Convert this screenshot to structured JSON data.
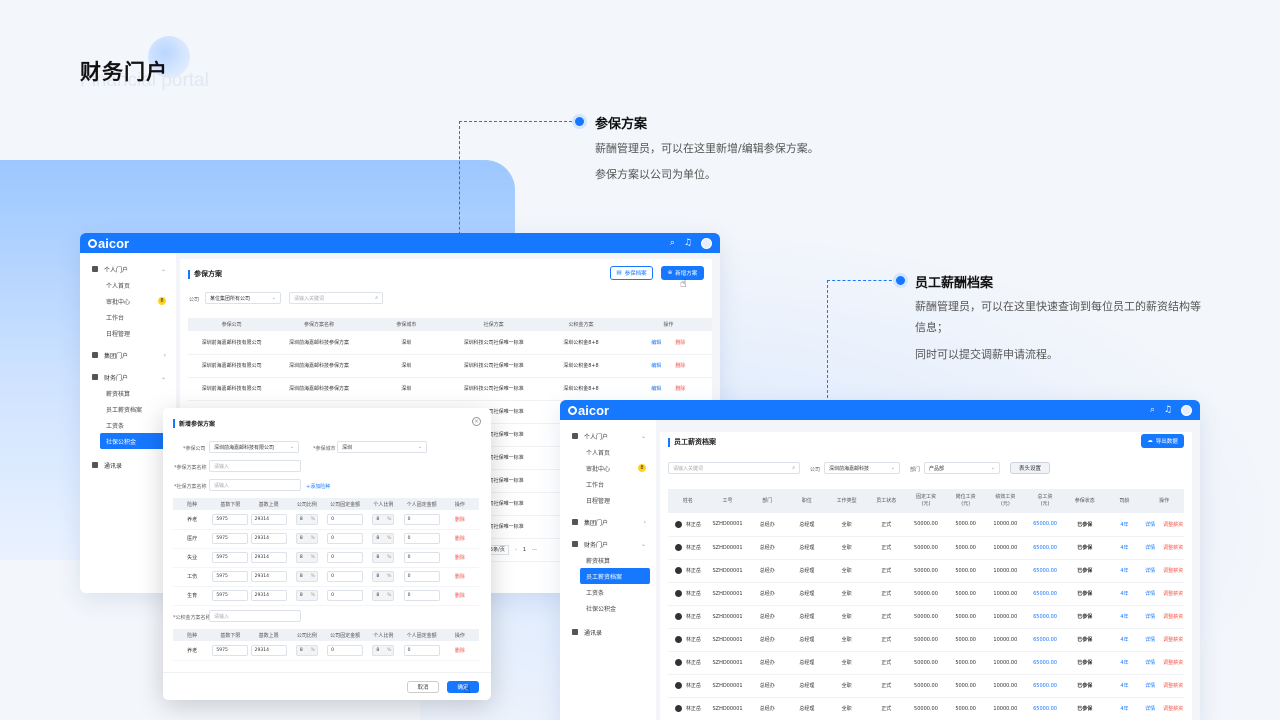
{
  "hero": {
    "title": "财务门户",
    "subtitle": "Financial portal"
  },
  "callout1": {
    "title": "参保方案",
    "line1": "薪酬管理员，可以在这里新增/编辑参保方案。",
    "line2": "参保方案以公司为单位。"
  },
  "callout2": {
    "title": "员工薪酬档案",
    "line1": "薪酬管理员，可以在这里快速查询到每位员工的薪资结构等",
    "line1b": "信息；",
    "line2": "同时可以提交调薪申请流程。"
  },
  "app": {
    "logo": "aicor"
  },
  "sidebar": {
    "personal": "个人门户",
    "personal_home": "个人首页",
    "approval": "审批中心",
    "approval_badge": "8",
    "workbench": "工作台",
    "schedule": "日程管理",
    "group": "集团门户",
    "finance": "财务门户",
    "salary_calc": "薪资核算",
    "salary_file": "员工薪资档案",
    "payslip": "工资条",
    "social": "社保公积金",
    "contacts": "通讯录"
  },
  "win1": {
    "page_title": "参保方案",
    "btn_archive": "参保档案",
    "btn_add": "新增方案",
    "company_label": "公司",
    "company_value": "某位集团所有公司",
    "search_placeholder": "请输入关键词",
    "columns": [
      "参保公司",
      "参保方案名称",
      "参保城市",
      "社保方案",
      "公积金方案",
      "操作"
    ],
    "rows": [
      [
        "深圳前海嘉邮科技有限公司",
        "深圳前海嘉邮科技参保方案",
        "深圳",
        "深圳科技公司社保唯一标准",
        "深圳公积金8+8",
        "编辑",
        "删除"
      ],
      [
        "深圳前海嘉邮科技有限公司",
        "深圳前海嘉邮科技参保方案",
        "深圳",
        "深圳科技公司社保唯一标准",
        "深圳公积金8+8",
        "编辑",
        "删除"
      ],
      [
        "深圳前海嘉邮科技有限公司",
        "深圳前海嘉邮科技参保方案",
        "深圳",
        "深圳科技公司社保唯一标准",
        "深圳公积金8+8",
        "编辑",
        "删除"
      ]
    ],
    "extra_rows": [
      "深圳科技公司社保唯一标准",
      "深圳科技公司社保唯一标准",
      "深圳科技公司社保唯一标准",
      "深圳科技公司社保唯一标准",
      "深圳科技公司社保唯一标准",
      "深圳科技公司社保唯一标准"
    ],
    "pager_size": "5条/页",
    "pager_prev": "‹",
    "pager_page": "1",
    "pager_more": "···"
  },
  "modal": {
    "title": "新增参保方案",
    "company_label": "*参保公司",
    "company_value": "深圳前海嘉邮科技有限公司",
    "city_label": "*参保城市",
    "city_value": "深圳",
    "name_label": "*参保方案名称",
    "name_placeholder": "请输入",
    "social_label": "*社保方案名称",
    "social_placeholder": "请输入",
    "add_type": "+添加险种",
    "columns": [
      "险种",
      "基数下限",
      "基数上限",
      "公司比例",
      "公司固定金额",
      "个人比例",
      "个人固定金额",
      "操作"
    ],
    "rows": [
      {
        "type": "养老",
        "low": "5975",
        "high": "29314",
        "cr": "8",
        "cf": "0",
        "pr": "8",
        "pf": "0",
        "op": "删除"
      },
      {
        "type": "医疗",
        "low": "5975",
        "high": "29314",
        "cr": "8",
        "cf": "0",
        "pr": "8",
        "pf": "0",
        "op": "删除"
      },
      {
        "type": "失业",
        "low": "5975",
        "high": "29314",
        "cr": "8",
        "cf": "0",
        "pr": "8",
        "pf": "0",
        "op": "删除"
      },
      {
        "type": "工伤",
        "low": "5975",
        "high": "29314",
        "cr": "8",
        "cf": "0",
        "pr": "8",
        "pf": "0",
        "op": "删除"
      },
      {
        "type": "生育",
        "low": "5975",
        "high": "29314",
        "cr": "8",
        "cf": "0",
        "pr": "8",
        "pf": "0",
        "op": "删除"
      }
    ],
    "fund_label": "*公积金方案名称",
    "fund_placeholder": "请输入",
    "fund_rows": [
      {
        "type": "养老",
        "low": "5975",
        "high": "29314",
        "cr": "8",
        "cf": "0",
        "pr": "8",
        "pf": "0",
        "op": "删除"
      }
    ],
    "pct": "%",
    "cancel": "取消",
    "confirm": "确定"
  },
  "win2": {
    "page_title": "员工薪资档案",
    "btn_export": "导出数据",
    "search_placeholder": "请输入关键词",
    "company_label": "公司",
    "company_value": "深圳前海嘉邮科技",
    "dept_label": "部门",
    "dept_value": "产品部",
    "header_btn": "表头设置",
    "columns": [
      "姓名",
      "工号",
      "部门",
      "职位",
      "工作类型",
      "员工状态",
      "固定工资\n(元)",
      "岗位工资\n(元)",
      "绩效工资\n(元)",
      "总工资\n(元)",
      "参保状态",
      "司龄",
      "操作"
    ],
    "rows": [
      [
        "林正岳",
        "SZHD00001",
        "总经办",
        "总经理",
        "全职",
        "正式",
        "50000.00",
        "5000.00",
        "10000.00",
        "65000.00",
        "已参保",
        "4年",
        "详情",
        "调整薪资"
      ],
      [
        "林正岳",
        "SZHD00001",
        "总经办",
        "总经理",
        "全职",
        "正式",
        "50000.00",
        "5000.00",
        "10000.00",
        "65000.00",
        "已参保",
        "4年",
        "详情",
        "调整薪资"
      ],
      [
        "林正岳",
        "SZHD00001",
        "总经办",
        "总经理",
        "全职",
        "正式",
        "50000.00",
        "5000.00",
        "10000.00",
        "65000.00",
        "已参保",
        "4年",
        "详情",
        "调整薪资"
      ],
      [
        "林正岳",
        "SZHD00001",
        "总经办",
        "总经理",
        "全职",
        "正式",
        "50000.00",
        "5000.00",
        "10000.00",
        "65000.00",
        "已参保",
        "4年",
        "详情",
        "调整薪资"
      ],
      [
        "林正岳",
        "SZHD00001",
        "总经办",
        "总经理",
        "全职",
        "正式",
        "50000.00",
        "5000.00",
        "10000.00",
        "65000.00",
        "已参保",
        "4年",
        "详情",
        "调整薪资"
      ],
      [
        "林正岳",
        "SZHD00001",
        "总经办",
        "总经理",
        "全职",
        "正式",
        "50000.00",
        "5000.00",
        "10000.00",
        "65000.00",
        "已参保",
        "4年",
        "详情",
        "调整薪资"
      ],
      [
        "林正岳",
        "SZHD00001",
        "总经办",
        "总经理",
        "全职",
        "正式",
        "50000.00",
        "5000.00",
        "10000.00",
        "65000.00",
        "已参保",
        "4年",
        "详情",
        "调整薪资"
      ],
      [
        "林正岳",
        "SZHD00001",
        "总经办",
        "总经理",
        "全职",
        "正式",
        "50000.00",
        "5000.00",
        "10000.00",
        "65000.00",
        "已参保",
        "4年",
        "详情",
        "调整薪资"
      ],
      [
        "林正岳",
        "SZHD00001",
        "总经办",
        "总经理",
        "全职",
        "正式",
        "50000.00",
        "5000.00",
        "10000.00",
        "65000.00",
        "已参保",
        "4年",
        "详情",
        "调整薪资"
      ]
    ]
  }
}
